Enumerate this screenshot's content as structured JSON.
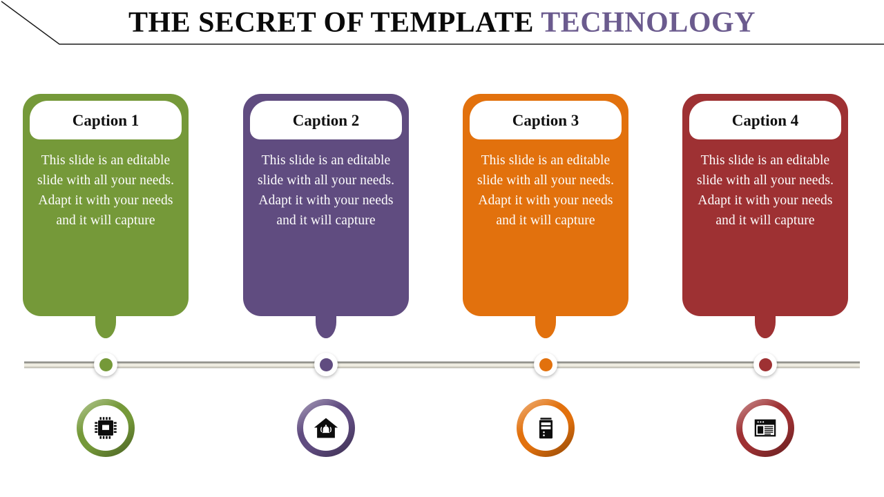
{
  "slide": {
    "title_main": "THE SECRET OF TEMPLATE ",
    "title_accent": "TECHNOLOGY",
    "background_color": "#ffffff",
    "accent_color": "#6b5b8e",
    "title_rule_color": "#1a1a1a"
  },
  "timeline": {
    "bar_color": "#b9b7ac",
    "node_ring_color": "#ffffff"
  },
  "cards": [
    {
      "caption": "Caption 1",
      "body": "This slide is an editable slide with all your needs. Adapt it with your needs and it will capture",
      "color": "#759939",
      "icon": "cpu-chip-icon"
    },
    {
      "caption": "Caption 2",
      "body": "This slide is an editable slide with all your needs. Adapt it with your needs and it will capture",
      "color": "#604c80",
      "icon": "home-alarm-icon"
    },
    {
      "caption": "Caption 3",
      "body": "This slide is an editable slide with all your needs. Adapt it with your needs and it will capture",
      "color": "#e2710d",
      "icon": "computer-tower-icon"
    },
    {
      "caption": "Caption 4",
      "body": "This slide is an editable slide with all your needs. Adapt it with your needs and it will capture",
      "color": "#9e3133",
      "icon": "browser-window-icon"
    }
  ]
}
